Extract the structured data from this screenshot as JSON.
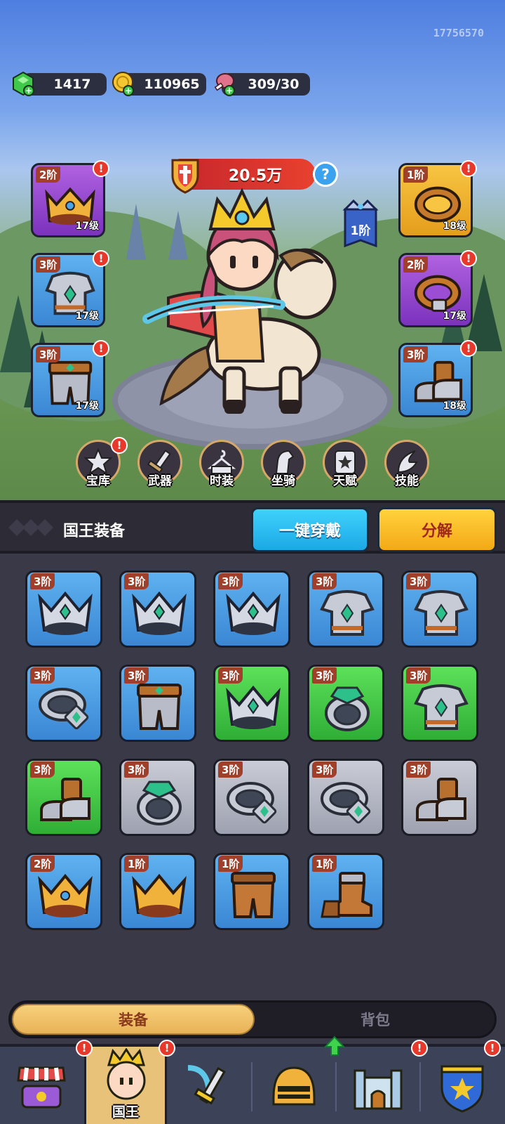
{
  "header": {
    "uid": "17756570",
    "resources": [
      {
        "name": "gems",
        "icon": "green-gem-icon",
        "value": "1417"
      },
      {
        "name": "gold",
        "icon": "gold-coin-icon",
        "value": "110965"
      },
      {
        "name": "stamina",
        "icon": "meat-icon",
        "value": "309/30"
      }
    ]
  },
  "hero": {
    "power": "20.5万",
    "help": "?",
    "tier_badge": "1阶"
  },
  "equipped": {
    "left": [
      {
        "slot": "crown",
        "tier": "2阶",
        "level": "17级",
        "rarity": "purple"
      },
      {
        "slot": "armor",
        "tier": "3阶",
        "level": "17级",
        "rarity": "blue"
      },
      {
        "slot": "pants",
        "tier": "3阶",
        "level": "17级",
        "rarity": "blue"
      }
    ],
    "right": [
      {
        "slot": "ring",
        "tier": "1阶",
        "level": "18级",
        "rarity": "gold"
      },
      {
        "slot": "ring",
        "tier": "2阶",
        "level": "17级",
        "rarity": "purple"
      },
      {
        "slot": "boots",
        "tier": "3阶",
        "level": "18级",
        "rarity": "blue"
      }
    ]
  },
  "menu": [
    {
      "label": "宝库",
      "icon": "treasury-icon"
    },
    {
      "label": "武器",
      "icon": "weapon-icon"
    },
    {
      "label": "时装",
      "icon": "outfit-icon"
    },
    {
      "label": "坐骑",
      "icon": "mount-icon"
    },
    {
      "label": "天赋",
      "icon": "talent-icon"
    },
    {
      "label": "技能",
      "icon": "skill-icon"
    }
  ],
  "section": {
    "title": "国王装备",
    "wear_all": "一键穿戴",
    "decompose": "分解"
  },
  "inventory": [
    {
      "tier": "3阶",
      "item": "crown",
      "rarity": "blue"
    },
    {
      "tier": "3阶",
      "item": "crown",
      "rarity": "blue"
    },
    {
      "tier": "3阶",
      "item": "crown",
      "rarity": "blue"
    },
    {
      "tier": "3阶",
      "item": "armor",
      "rarity": "blue"
    },
    {
      "tier": "3阶",
      "item": "armor",
      "rarity": "blue"
    },
    {
      "tier": "3阶",
      "item": "ring",
      "rarity": "blue"
    },
    {
      "tier": "3阶",
      "item": "pants",
      "rarity": "blue"
    },
    {
      "tier": "3阶",
      "item": "crown",
      "rarity": "green"
    },
    {
      "tier": "3阶",
      "item": "ring-gem",
      "rarity": "green"
    },
    {
      "tier": "3阶",
      "item": "armor",
      "rarity": "green"
    },
    {
      "tier": "3阶",
      "item": "boots",
      "rarity": "green"
    },
    {
      "tier": "3阶",
      "item": "ring-gem",
      "rarity": "grey"
    },
    {
      "tier": "3阶",
      "item": "ring",
      "rarity": "grey"
    },
    {
      "tier": "3阶",
      "item": "ring",
      "rarity": "grey"
    },
    {
      "tier": "3阶",
      "item": "boots",
      "rarity": "grey"
    },
    {
      "tier": "2阶",
      "item": "gold-crown-gem",
      "rarity": "blue"
    },
    {
      "tier": "1阶",
      "item": "gold-crown",
      "rarity": "blue"
    },
    {
      "tier": "1阶",
      "item": "leather-pants",
      "rarity": "blue"
    },
    {
      "tier": "1阶",
      "item": "leather-boots",
      "rarity": "blue"
    }
  ],
  "tabs": {
    "active": "装备",
    "inactive": "背包"
  },
  "bottom_nav": [
    {
      "label": "",
      "icon": "shop-icon",
      "alert": false
    },
    {
      "label": "国王",
      "icon": "king-icon",
      "alert": true
    },
    {
      "label": "",
      "icon": "sword-bow-icon",
      "alert": true
    },
    {
      "label": "",
      "icon": "helmet-icon",
      "alert": false,
      "up_arrow": true
    },
    {
      "label": "",
      "icon": "castle-icon",
      "alert": true
    },
    {
      "label": "",
      "icon": "shield-icon",
      "alert": true
    }
  ],
  "colors": {
    "purple": "#9b4dd4",
    "blue": "#4a9be3",
    "gold": "#eeb530",
    "green": "#41c645",
    "grey": "#b3b6c2",
    "tier_tag": "#a0402a",
    "alert": "#e8382c"
  }
}
